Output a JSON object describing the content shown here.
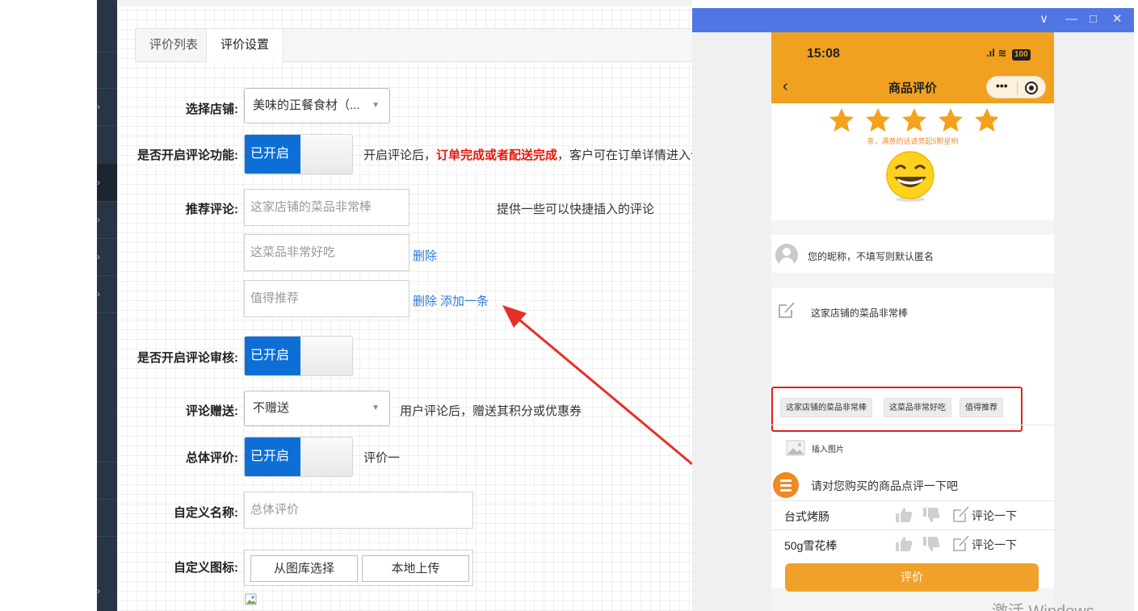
{
  "admin": {
    "tabs": [
      {
        "label": "评价列表",
        "active": false
      },
      {
        "label": "评价设置",
        "active": true
      }
    ],
    "shop": {
      "label": "选择店铺:",
      "value": "美味的正餐食材（..."
    },
    "comment_enable": {
      "label": "是否开启评论功能:",
      "toggle": "已开启",
      "desc_prefix": "开启评论后，",
      "desc_highlight": "订单完成或者配送完成",
      "desc_suffix": "，客户可在订单详情进入评"
    },
    "recommend": {
      "label": "推荐评论:",
      "hint": "提供一些可以快捷插入的评论",
      "items": [
        "这家店铺的菜品非常棒",
        "这菜品非常好吃",
        "值得推荐"
      ],
      "delete": "删除",
      "add": "添加一条"
    },
    "review_audit": {
      "label": "是否开启评论审核:",
      "toggle": "已开启"
    },
    "gift": {
      "label": "评论赠送:",
      "value": "不赠送",
      "desc": "用户评论后，赠送其积分或优惠券"
    },
    "overall": {
      "label": "总体评价:",
      "toggle": "已开启",
      "desc": "评价一"
    },
    "custom_name": {
      "label": "自定义名称:",
      "placeholder": "总体评价"
    },
    "custom_icon": {
      "label": "自定义图标:",
      "btn_library": "从图库选择",
      "btn_upload": "本地上传"
    }
  },
  "phone": {
    "time": "15:08",
    "battery": "100",
    "nav_title": "商品评价",
    "rating_hint": "亲，满意的话请亮起5颗星哟",
    "stars": 5,
    "nickname_placeholder": "您的昵称，不填写则默认匿名",
    "comment_text": "这家店铺的菜品非常棒",
    "chips": [
      "这家店铺的菜品非常棒",
      "这菜品非常好吃",
      "值得推荐"
    ],
    "insert_image": "插入图片",
    "goods_prompt": "请对您购买的商品点评一下吧",
    "goods": [
      {
        "name": "台式烤肠",
        "comment": "评论一下"
      },
      {
        "name": "50g雪花棒",
        "comment": "评论一下"
      }
    ],
    "submit": "评价"
  },
  "window": {
    "min": "—",
    "max": "□",
    "close": "✕",
    "dropdown": "∨"
  },
  "watermark": "激活 Windows",
  "colors": {
    "toggle_on": "#0d6fd6",
    "link": "#2d7bd4",
    "highlight": "#e8170c",
    "phone_accent": "#f0a11f",
    "window_title": "#4f76e3"
  }
}
